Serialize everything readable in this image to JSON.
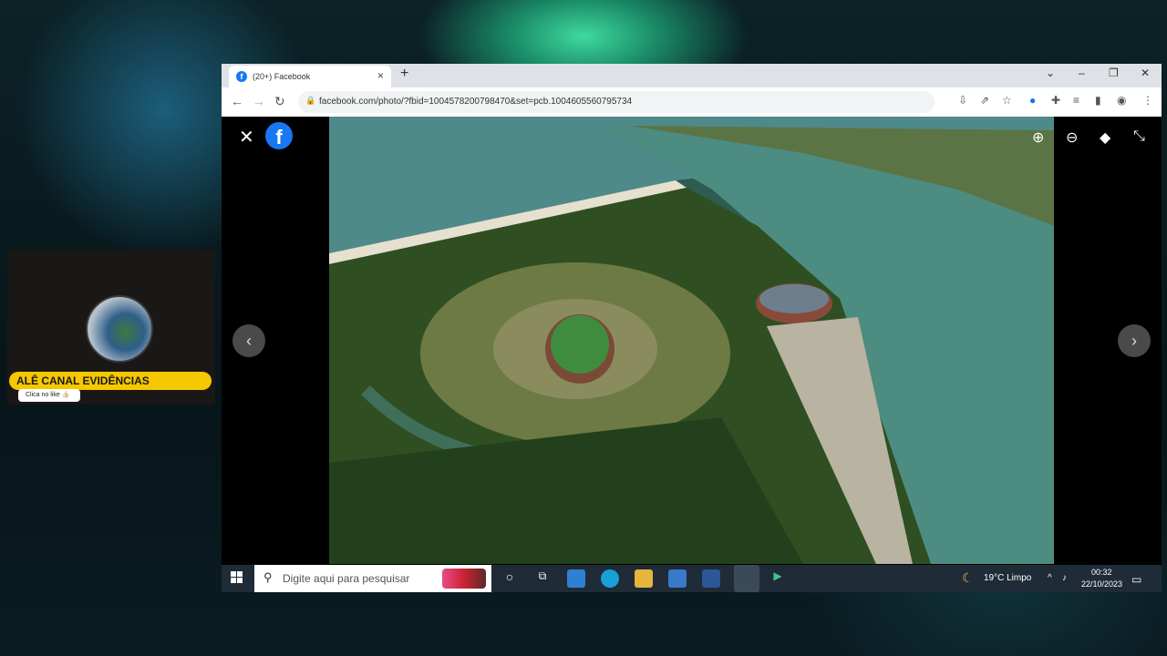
{
  "overlay": {
    "channel_name": "ALÊ CANAL EVIDÊNCIAS",
    "like_text": "Clica no like 👍🏻"
  },
  "browser": {
    "tab_title": "(20+) Facebook",
    "tab_favicon": "f",
    "url": "facebook.com/photo/?fbid=1004578200798470&set=pcb.1004605560795734"
  },
  "viewer": {
    "logo": "f",
    "close_glyph": "✕",
    "prev_glyph": "‹",
    "next_glyph": "›",
    "icons": [
      "zoom-in-icon",
      "zoom-out-icon",
      "tag-icon",
      "collapse-icon"
    ]
  },
  "taskbar": {
    "search_placeholder": "Digite aqui para pesquisar",
    "weather": "19°C  Limpo",
    "time": "00:32",
    "date": "22/10/2023"
  },
  "colors": {
    "facebook_blue": "#1877f2",
    "taskbar": "#1f2b36",
    "channel_yellow": "#f5c800"
  }
}
